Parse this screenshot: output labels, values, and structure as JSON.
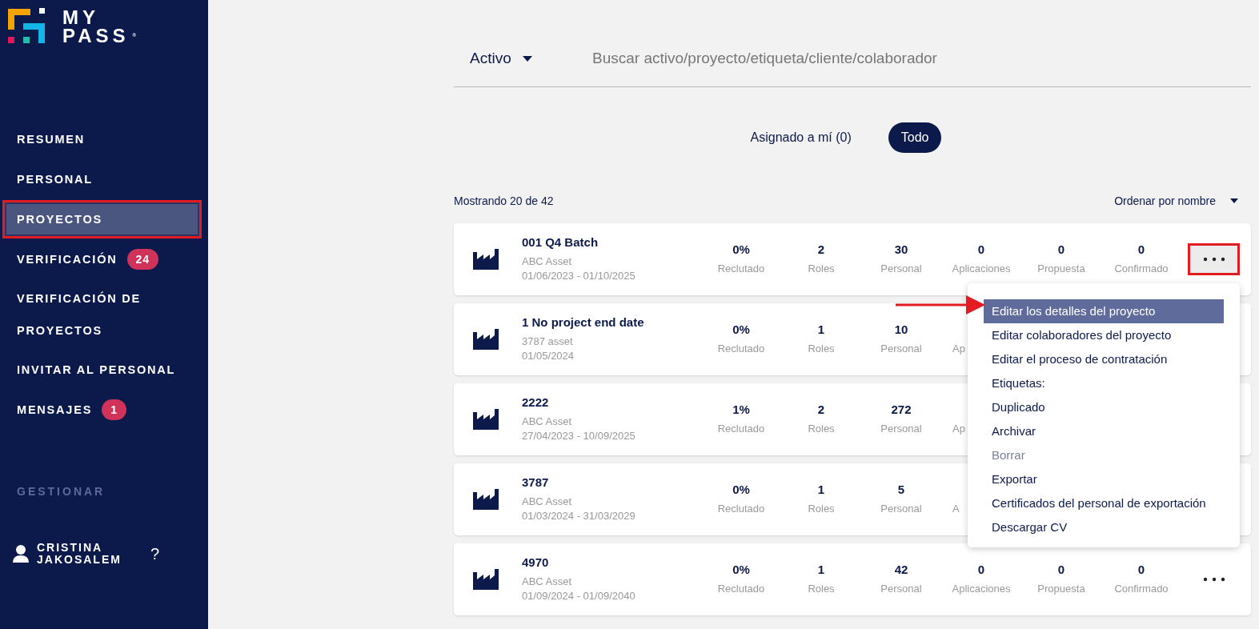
{
  "brand": {
    "line_1": "MY",
    "line_2": "PASS",
    "mark": "®"
  },
  "sidebar": {
    "items": [
      {
        "label": "RESUMEN",
        "selected": false,
        "annotated": false
      },
      {
        "label": "PERSONAL",
        "selected": false,
        "annotated": false
      },
      {
        "label": "PROYECTOS",
        "selected": true,
        "annotated": true
      },
      {
        "label": "VERIFICACIÓN",
        "selected": false,
        "annotated": false,
        "badge": "24"
      },
      {
        "label": "VERIFICACIÓN DE PROYECTOS",
        "selected": false,
        "annotated": false
      },
      {
        "label": "INVITAR AL PERSONAL",
        "selected": false,
        "annotated": false
      },
      {
        "label": "MENSAJES",
        "selected": false,
        "annotated": false,
        "badge": "1"
      }
    ],
    "section": "GESTIONAR",
    "user": "CRISTINA JAKOSALEM",
    "help": "?"
  },
  "filter": {
    "status": "Activo",
    "placeholder": "Buscar activo/proyecto/etiqueta/cliente/colaborador"
  },
  "tabs": [
    {
      "label": "Asignado a mí (0)",
      "selected": false
    },
    {
      "label": "Todo",
      "selected": true
    }
  ],
  "count": "Mostrando 20 de 42",
  "sort": "Ordenar por nombre",
  "projects": [
    {
      "name": "001 Q4 Batch",
      "asset": "ABC Asset",
      "dates": "01/06/2023 - 01/10/2025",
      "stats": [
        {
          "value": "0%",
          "label": "Reclutado"
        },
        {
          "value": "2",
          "label": "Roles"
        },
        {
          "value": "30",
          "label": "Personal"
        },
        {
          "value": "0",
          "label": "Aplicaciones"
        },
        {
          "value": "0",
          "label": "Propuesta"
        },
        {
          "value": "0",
          "label": "Confirmado"
        }
      ],
      "more": {
        "open": true,
        "annotated": true
      }
    },
    {
      "name": "1 No project end date",
      "asset": "3787 asset",
      "dates": "01/05/2024",
      "stats": [
        {
          "value": "0%",
          "label": "Reclutado"
        },
        {
          "value": "1",
          "label": "Roles"
        },
        {
          "value": "10",
          "label": "Personal"
        },
        {
          "label": "Ap"
        }
      ]
    },
    {
      "name": "2222",
      "asset": "ABC Asset",
      "dates": "27/04/2023 - 10/09/2025",
      "stats": [
        {
          "value": "1%",
          "label": "Reclutado"
        },
        {
          "value": "2",
          "label": "Roles"
        },
        {
          "value": "272",
          "label": "Personal"
        },
        {
          "label": "Ap"
        }
      ]
    },
    {
      "name": "3787",
      "asset": "ABC Asset",
      "dates": "01/03/2024 - 31/03/2029",
      "stats": [
        {
          "value": "0%",
          "label": "Reclutado"
        },
        {
          "value": "1",
          "label": "Roles"
        },
        {
          "value": "5",
          "label": "Personal"
        },
        {
          "label": "A"
        }
      ]
    },
    {
      "name": "4970",
      "asset": "ABC Asset",
      "dates": "01/09/2024 - 01/09/2040",
      "stats": [
        {
          "value": "0%",
          "label": "Reclutado"
        },
        {
          "value": "1",
          "label": "Roles"
        },
        {
          "value": "42",
          "label": "Personal"
        },
        {
          "value": "0",
          "label": "Aplicaciones"
        },
        {
          "value": "0",
          "label": "Propuesta"
        },
        {
          "value": "0",
          "label": "Confirmado"
        }
      ],
      "more": {
        "open": false,
        "annotated": false
      }
    }
  ],
  "menu": {
    "items": [
      {
        "label": "Editar los detalles del proyecto",
        "selected": true,
        "disabled": false,
        "annotated": true
      },
      {
        "label": "Editar colaboradores del proyecto",
        "selected": false,
        "disabled": false,
        "annotated": false
      },
      {
        "label": "Editar el proceso de contratación",
        "selected": false,
        "disabled": false,
        "annotated": false
      },
      {
        "label": "Etiquetas:",
        "selected": false,
        "disabled": false,
        "annotated": false
      },
      {
        "label": "Duplicado",
        "selected": false,
        "disabled": false,
        "annotated": false
      },
      {
        "label": "Archivar",
        "selected": false,
        "disabled": false,
        "annotated": false
      },
      {
        "label": "Borrar",
        "selected": false,
        "disabled": true,
        "annotated": false
      },
      {
        "label": "Exportar",
        "selected": false,
        "disabled": false,
        "annotated": false
      },
      {
        "label": "Certificados del personal de exportación",
        "selected": false,
        "disabled": false,
        "annotated": false
      },
      {
        "label": "Descargar CV",
        "selected": false,
        "disabled": false,
        "annotated": false
      }
    ]
  }
}
